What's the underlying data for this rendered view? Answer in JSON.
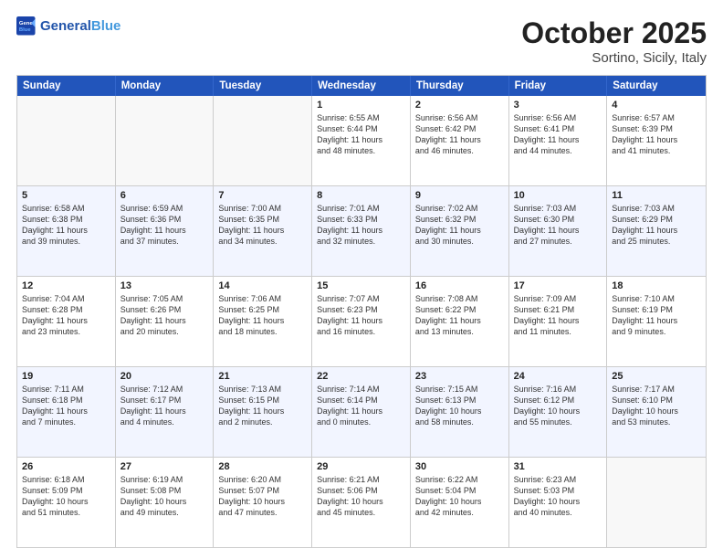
{
  "header": {
    "logo_general": "General",
    "logo_blue": "Blue",
    "month": "October 2025",
    "location": "Sortino, Sicily, Italy"
  },
  "days_of_week": [
    "Sunday",
    "Monday",
    "Tuesday",
    "Wednesday",
    "Thursday",
    "Friday",
    "Saturday"
  ],
  "weeks": [
    [
      {
        "day": "",
        "lines": []
      },
      {
        "day": "",
        "lines": []
      },
      {
        "day": "",
        "lines": []
      },
      {
        "day": "1",
        "lines": [
          "Sunrise: 6:55 AM",
          "Sunset: 6:44 PM",
          "Daylight: 11 hours",
          "and 48 minutes."
        ]
      },
      {
        "day": "2",
        "lines": [
          "Sunrise: 6:56 AM",
          "Sunset: 6:42 PM",
          "Daylight: 11 hours",
          "and 46 minutes."
        ]
      },
      {
        "day": "3",
        "lines": [
          "Sunrise: 6:56 AM",
          "Sunset: 6:41 PM",
          "Daylight: 11 hours",
          "and 44 minutes."
        ]
      },
      {
        "day": "4",
        "lines": [
          "Sunrise: 6:57 AM",
          "Sunset: 6:39 PM",
          "Daylight: 11 hours",
          "and 41 minutes."
        ]
      }
    ],
    [
      {
        "day": "5",
        "lines": [
          "Sunrise: 6:58 AM",
          "Sunset: 6:38 PM",
          "Daylight: 11 hours",
          "and 39 minutes."
        ]
      },
      {
        "day": "6",
        "lines": [
          "Sunrise: 6:59 AM",
          "Sunset: 6:36 PM",
          "Daylight: 11 hours",
          "and 37 minutes."
        ]
      },
      {
        "day": "7",
        "lines": [
          "Sunrise: 7:00 AM",
          "Sunset: 6:35 PM",
          "Daylight: 11 hours",
          "and 34 minutes."
        ]
      },
      {
        "day": "8",
        "lines": [
          "Sunrise: 7:01 AM",
          "Sunset: 6:33 PM",
          "Daylight: 11 hours",
          "and 32 minutes."
        ]
      },
      {
        "day": "9",
        "lines": [
          "Sunrise: 7:02 AM",
          "Sunset: 6:32 PM",
          "Daylight: 11 hours",
          "and 30 minutes."
        ]
      },
      {
        "day": "10",
        "lines": [
          "Sunrise: 7:03 AM",
          "Sunset: 6:30 PM",
          "Daylight: 11 hours",
          "and 27 minutes."
        ]
      },
      {
        "day": "11",
        "lines": [
          "Sunrise: 7:03 AM",
          "Sunset: 6:29 PM",
          "Daylight: 11 hours",
          "and 25 minutes."
        ]
      }
    ],
    [
      {
        "day": "12",
        "lines": [
          "Sunrise: 7:04 AM",
          "Sunset: 6:28 PM",
          "Daylight: 11 hours",
          "and 23 minutes."
        ]
      },
      {
        "day": "13",
        "lines": [
          "Sunrise: 7:05 AM",
          "Sunset: 6:26 PM",
          "Daylight: 11 hours",
          "and 20 minutes."
        ]
      },
      {
        "day": "14",
        "lines": [
          "Sunrise: 7:06 AM",
          "Sunset: 6:25 PM",
          "Daylight: 11 hours",
          "and 18 minutes."
        ]
      },
      {
        "day": "15",
        "lines": [
          "Sunrise: 7:07 AM",
          "Sunset: 6:23 PM",
          "Daylight: 11 hours",
          "and 16 minutes."
        ]
      },
      {
        "day": "16",
        "lines": [
          "Sunrise: 7:08 AM",
          "Sunset: 6:22 PM",
          "Daylight: 11 hours",
          "and 13 minutes."
        ]
      },
      {
        "day": "17",
        "lines": [
          "Sunrise: 7:09 AM",
          "Sunset: 6:21 PM",
          "Daylight: 11 hours",
          "and 11 minutes."
        ]
      },
      {
        "day": "18",
        "lines": [
          "Sunrise: 7:10 AM",
          "Sunset: 6:19 PM",
          "Daylight: 11 hours",
          "and 9 minutes."
        ]
      }
    ],
    [
      {
        "day": "19",
        "lines": [
          "Sunrise: 7:11 AM",
          "Sunset: 6:18 PM",
          "Daylight: 11 hours",
          "and 7 minutes."
        ]
      },
      {
        "day": "20",
        "lines": [
          "Sunrise: 7:12 AM",
          "Sunset: 6:17 PM",
          "Daylight: 11 hours",
          "and 4 minutes."
        ]
      },
      {
        "day": "21",
        "lines": [
          "Sunrise: 7:13 AM",
          "Sunset: 6:15 PM",
          "Daylight: 11 hours",
          "and 2 minutes."
        ]
      },
      {
        "day": "22",
        "lines": [
          "Sunrise: 7:14 AM",
          "Sunset: 6:14 PM",
          "Daylight: 11 hours",
          "and 0 minutes."
        ]
      },
      {
        "day": "23",
        "lines": [
          "Sunrise: 7:15 AM",
          "Sunset: 6:13 PM",
          "Daylight: 10 hours",
          "and 58 minutes."
        ]
      },
      {
        "day": "24",
        "lines": [
          "Sunrise: 7:16 AM",
          "Sunset: 6:12 PM",
          "Daylight: 10 hours",
          "and 55 minutes."
        ]
      },
      {
        "day": "25",
        "lines": [
          "Sunrise: 7:17 AM",
          "Sunset: 6:10 PM",
          "Daylight: 10 hours",
          "and 53 minutes."
        ]
      }
    ],
    [
      {
        "day": "26",
        "lines": [
          "Sunrise: 6:18 AM",
          "Sunset: 5:09 PM",
          "Daylight: 10 hours",
          "and 51 minutes."
        ]
      },
      {
        "day": "27",
        "lines": [
          "Sunrise: 6:19 AM",
          "Sunset: 5:08 PM",
          "Daylight: 10 hours",
          "and 49 minutes."
        ]
      },
      {
        "day": "28",
        "lines": [
          "Sunrise: 6:20 AM",
          "Sunset: 5:07 PM",
          "Daylight: 10 hours",
          "and 47 minutes."
        ]
      },
      {
        "day": "29",
        "lines": [
          "Sunrise: 6:21 AM",
          "Sunset: 5:06 PM",
          "Daylight: 10 hours",
          "and 45 minutes."
        ]
      },
      {
        "day": "30",
        "lines": [
          "Sunrise: 6:22 AM",
          "Sunset: 5:04 PM",
          "Daylight: 10 hours",
          "and 42 minutes."
        ]
      },
      {
        "day": "31",
        "lines": [
          "Sunrise: 6:23 AM",
          "Sunset: 5:03 PM",
          "Daylight: 10 hours",
          "and 40 minutes."
        ]
      },
      {
        "day": "",
        "lines": []
      }
    ]
  ]
}
